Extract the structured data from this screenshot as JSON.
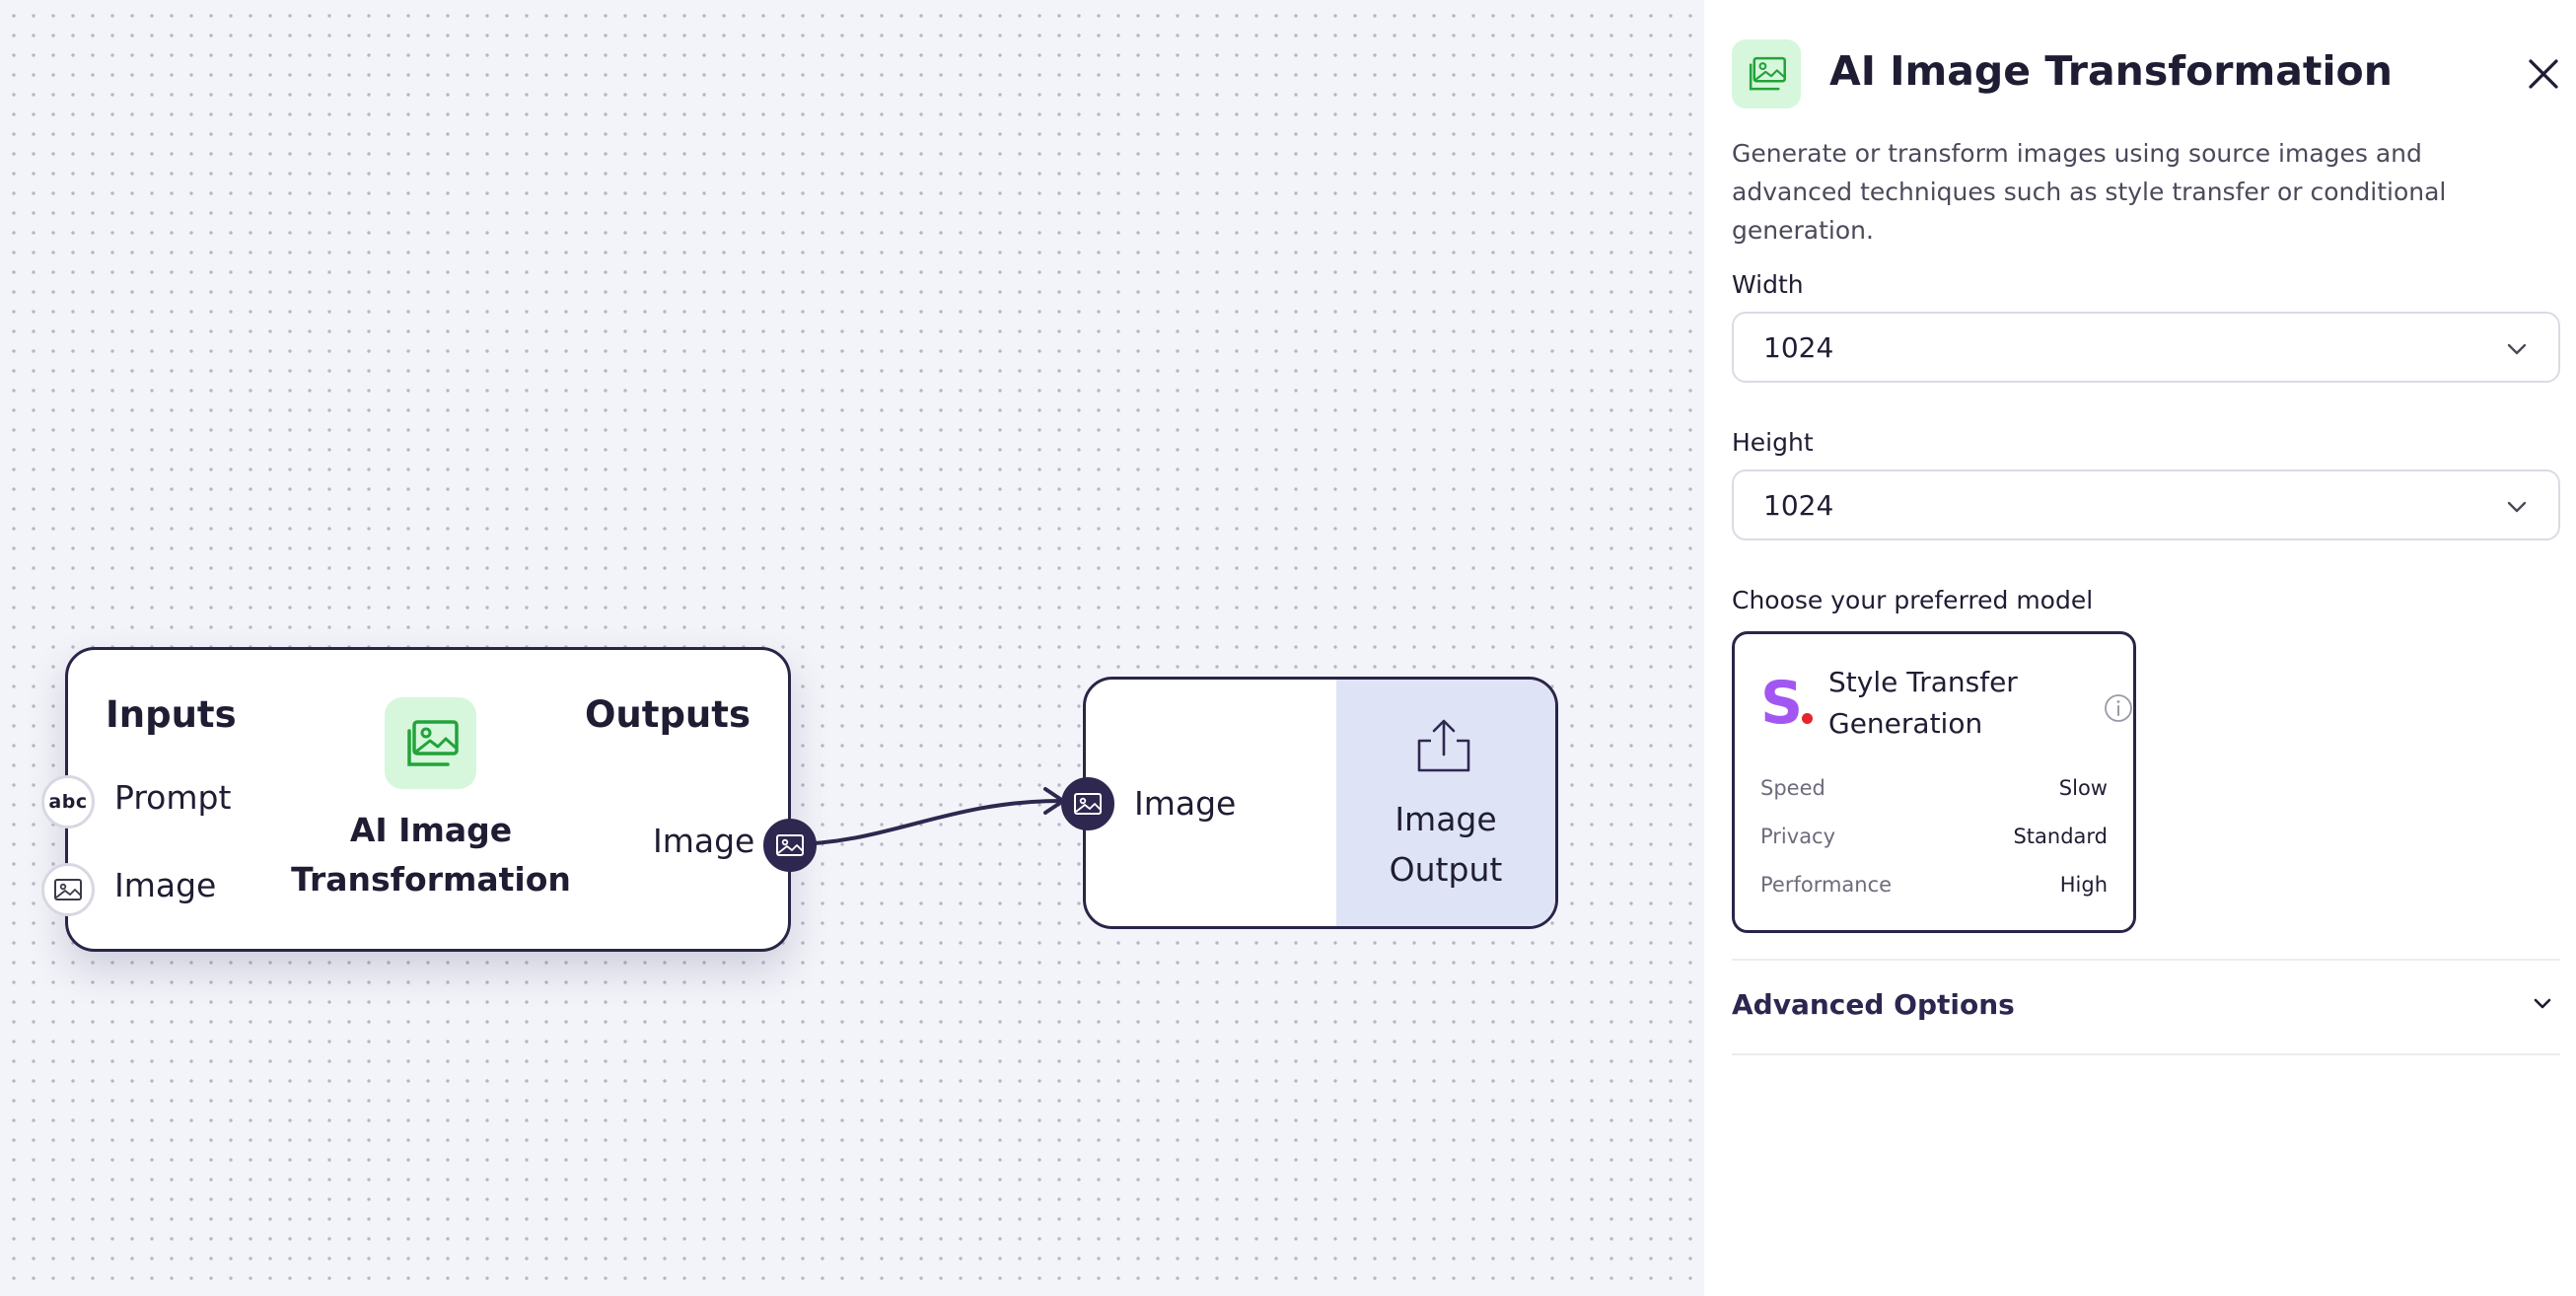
{
  "canvas": {
    "ai_node": {
      "inputs_heading": "Inputs",
      "outputs_heading": "Outputs",
      "title": "AI Image Transformation",
      "inputs": [
        {
          "label": "Prompt",
          "icon": "text-abc-icon",
          "icon_text": "abc"
        },
        {
          "label": "Image",
          "icon": "image-icon"
        }
      ],
      "outputs": [
        {
          "label": "Image",
          "icon": "image-icon"
        }
      ]
    },
    "output_node": {
      "input_label": "Image",
      "title": "Image Output",
      "icon": "upload-icon"
    }
  },
  "panel": {
    "title": "AI Image Transformation",
    "description": "Generate or transform images using source images and advanced techniques such as style transfer or conditional generation.",
    "width": {
      "label": "Width",
      "value": "1024"
    },
    "height": {
      "label": "Height",
      "value": "1024"
    },
    "model_section_label": "Choose your preferred model",
    "model": {
      "logo_text": "S",
      "name": "Style Transfer Generation",
      "specs": [
        {
          "key": "Speed",
          "value": "Slow"
        },
        {
          "key": "Privacy",
          "value": "Standard"
        },
        {
          "key": "Performance",
          "value": "High"
        }
      ]
    },
    "advanced_label": "Advanced Options"
  },
  "colors": {
    "node_border": "#2a2548",
    "icon_bg": "#d6f7dc",
    "icon_green": "#22a33a",
    "output_panel_bg": "#dfe3f6",
    "model_logo": "#a257f2",
    "model_logo_dot": "#e3262b"
  }
}
